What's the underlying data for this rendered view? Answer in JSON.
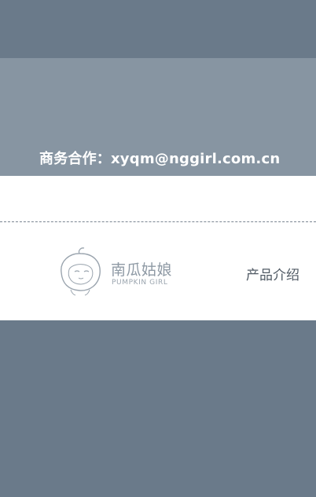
{
  "contact": {
    "text": "商务合作：xyqm@nggirl.com.cn",
    "edge_glyph_1": "",
    "edge_glyph_2": ""
  },
  "logo": {
    "cn_name": "南瓜姑娘",
    "en_name": "PUMPKIN GIRL",
    "icon_name": "pumpkin-girl-logo-icon"
  },
  "footer_nav": {
    "product_intro": "产品介绍"
  },
  "colors": {
    "dark_band": "#6a7a8a",
    "contact_band": "#8795a2",
    "panel": "#ffffff",
    "logo_gray": "#8f9aa5",
    "nav_text": "#505a64"
  }
}
